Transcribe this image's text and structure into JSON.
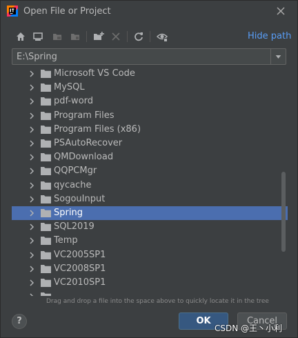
{
  "window": {
    "title": "Open File or Project"
  },
  "toolbar": {
    "buttons": [
      {
        "name": "home-icon"
      },
      {
        "name": "desktop-icon"
      },
      {
        "name": "project-folder-icon"
      },
      {
        "name": "module-folder-icon"
      },
      {
        "name": "new-folder-icon"
      },
      {
        "name": "delete-icon"
      },
      {
        "name": "refresh-icon"
      },
      {
        "name": "show-hidden-files-icon"
      }
    ],
    "hide_path_label": "Hide path"
  },
  "path": {
    "value": "E:\\Spring"
  },
  "tree": {
    "selected_index": 10,
    "items": [
      {
        "label": "Microsoft VS Code"
      },
      {
        "label": "MySQL"
      },
      {
        "label": "pdf-word"
      },
      {
        "label": "Program Files"
      },
      {
        "label": "Program Files (x86)"
      },
      {
        "label": "PSAutoRecover"
      },
      {
        "label": "QMDownload"
      },
      {
        "label": "QQPCMgr"
      },
      {
        "label": "qycache"
      },
      {
        "label": "SogouInput"
      },
      {
        "label": "Spring"
      },
      {
        "label": "SQL2019"
      },
      {
        "label": "Temp"
      },
      {
        "label": "VC2005SP1"
      },
      {
        "label": "VC2008SP1"
      },
      {
        "label": "VC2010SP1"
      }
    ]
  },
  "hint": "Drag and drop a file into the space above to quickly locate it in the tree",
  "footer": {
    "help_label": "?",
    "ok_label": "OK",
    "cancel_label": "Cancel"
  },
  "watermark": "CSDN @王丶小利",
  "colors": {
    "background": "#3c3f41",
    "selection": "#4b6eaf",
    "link": "#589df6",
    "ok_button": "#365880"
  }
}
